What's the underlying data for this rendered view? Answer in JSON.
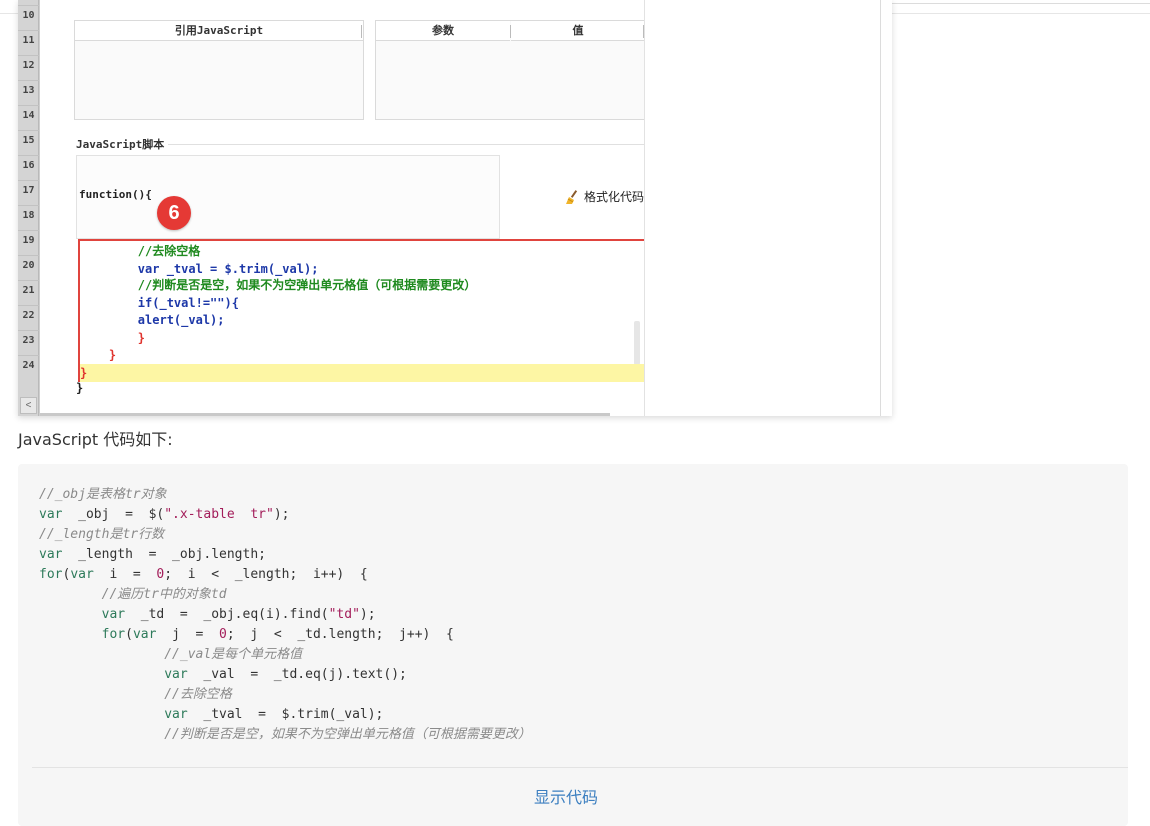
{
  "line_numbers": [
    "10",
    "11",
    "12",
    "13",
    "14",
    "15",
    "16",
    "17",
    "18",
    "19",
    "20",
    "21",
    "22",
    "23",
    "24"
  ],
  "gutter": {
    "scroll_left_glyph": "<"
  },
  "grid_left": {
    "header": "引用JavaScript"
  },
  "grid_right": {
    "header_param": "参数",
    "header_value": "值"
  },
  "script_section": {
    "label": "JavaScript脚本",
    "function_header": "function(){",
    "closing_brace": "}"
  },
  "badge": {
    "number": "6"
  },
  "format_button": {
    "label": "格式化代码",
    "icon": "broom-icon"
  },
  "editor_lines": [
    {
      "text": "        //去除空格",
      "color": "green"
    },
    {
      "text": "        var _tval = $.trim(_val);",
      "color": "navy"
    },
    {
      "text": "        //判断是否是空，如果不为空弹出单元格值（可根据需要更改）",
      "color": "green"
    },
    {
      "text": "        if(_tval!=\"\"){",
      "color": "navy"
    },
    {
      "text": "        alert(_val);",
      "color": "navy"
    },
    {
      "text": "        }",
      "color": "red"
    },
    {
      "text": "    }",
      "color": "red"
    },
    {
      "text": "}",
      "color": "red",
      "highlight": true
    }
  ],
  "caption": "JavaScript 代码如下:",
  "code_block": {
    "lines": [
      "//_obj是表格tr对象",
      "var  _obj  =  $(\".x-table  tr\");",
      "//_length是tr行数",
      "var  _length  =  _obj.length;",
      "for(var  i  =  0;  i  <  _length;  i++)  {",
      "        //遍历tr中的对象td",
      "        var  _td  =  _obj.eq(i).find(\"td\");",
      "        for(var  j  =  0;  j  <  _td.length;  j++)  {",
      "                //_val是每个单元格值",
      "                var  _val  =  _td.eq(j).text();",
      "                //去除空格",
      "                var  _tval  =  $.trim(_val);",
      "                //判断是否是空，如果不为空弹出单元格值（可根据需要更改）"
    ],
    "show_code_label": "显示代码"
  },
  "colors": {
    "highlight_frame": "#e0443e",
    "badge": "#e53935",
    "link": "#3c7fc0",
    "comment": "#8a8a8a",
    "keyword": "#2d7a5a",
    "string": "#a31d5a"
  }
}
